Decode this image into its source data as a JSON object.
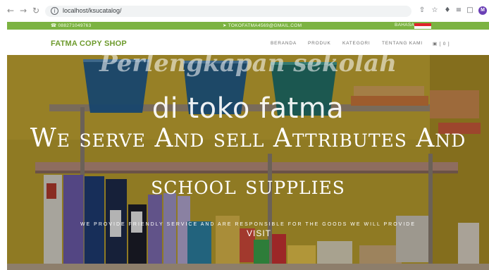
{
  "browser": {
    "url": "localhost/ksucatalog/",
    "profile_initial": "M"
  },
  "topbar": {
    "phone": "☎ 088271049763",
    "email": "➤ TOKOFATMA4569@GMAIL.COM",
    "language": "BAHASA"
  },
  "header": {
    "logo": "FATMA COPY SHOP",
    "nav": [
      {
        "label": "BERANDA"
      },
      {
        "label": "PRODUK"
      },
      {
        "label": "KATEGORI"
      },
      {
        "label": "TENTANG KAMI"
      },
      {
        "label": "▣ [ 0 ]"
      }
    ]
  },
  "hero": {
    "faint_text": "Perlengkapan sekolah",
    "subtitle": "di toko fatma",
    "title_line1": "We serve And sell Attributes And",
    "title_line2": "school supplies",
    "description": "WE PROVIDE FRIENDLY SERVICE AND ARE RESPONSIBLE FOR THE GOODS WE WILL PROVIDE",
    "button": "VISIT"
  },
  "colors": {
    "brand_green": "#7cb342",
    "logo_green": "#6e9b2e"
  }
}
